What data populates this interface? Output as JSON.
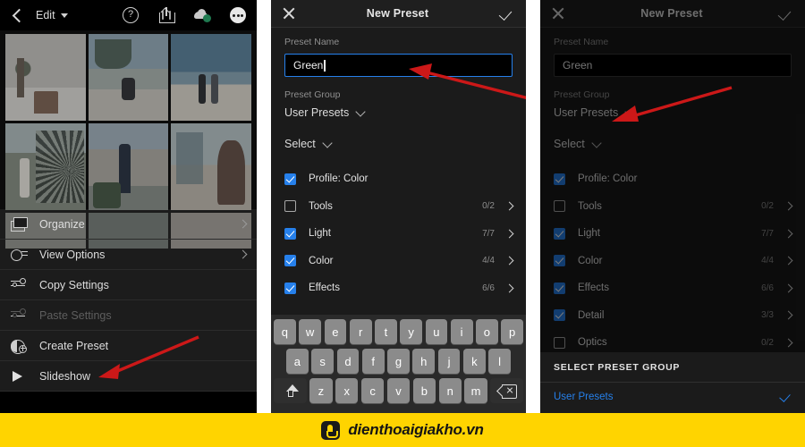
{
  "panel_left": {
    "topbar": {
      "back_icon": "back-chevron-icon",
      "title": "Edit",
      "icons": [
        {
          "name": "help-icon",
          "glyph": "?"
        },
        {
          "name": "share-icon",
          "glyph": "share"
        },
        {
          "name": "cloud-sync-icon",
          "glyph": "cloud"
        },
        {
          "name": "more-options-icon",
          "glyph": "•••"
        }
      ]
    },
    "menu": [
      {
        "label": "Organize",
        "icon": "organize-icon",
        "has_arrow": true,
        "disabled": false
      },
      {
        "label": "View Options",
        "icon": "view-options-icon",
        "has_arrow": true,
        "disabled": false
      },
      {
        "label": "Copy Settings",
        "icon": "copy-settings-icon",
        "has_arrow": false,
        "disabled": false
      },
      {
        "label": "Paste Settings",
        "icon": "paste-settings-icon",
        "has_arrow": false,
        "disabled": true
      },
      {
        "label": "Create Preset",
        "icon": "create-preset-icon",
        "has_arrow": false,
        "disabled": false
      },
      {
        "label": "Slideshow",
        "icon": "slideshow-icon",
        "has_arrow": false,
        "disabled": false
      }
    ]
  },
  "panel_mid": {
    "header": {
      "close_icon": "close-icon",
      "title": "New Preset",
      "confirm_icon": "checkmark-icon"
    },
    "preset_name_label": "Preset Name",
    "preset_name_value": "Green",
    "preset_group_label": "Preset Group",
    "preset_group_value": "User Presets",
    "select_label": "Select",
    "items": [
      {
        "label": "Profile: Color",
        "checked": true,
        "count": "",
        "chevron": false
      },
      {
        "label": "Tools",
        "checked": false,
        "count": "0/2",
        "chevron": true
      },
      {
        "label": "Light",
        "checked": true,
        "count": "7/7",
        "chevron": true
      },
      {
        "label": "Color",
        "checked": true,
        "count": "4/4",
        "chevron": true
      },
      {
        "label": "Effects",
        "checked": true,
        "count": "6/6",
        "chevron": true
      }
    ],
    "keyboard": {
      "row1": [
        "q",
        "w",
        "e",
        "r",
        "t",
        "y",
        "u",
        "i",
        "o",
        "p"
      ],
      "row2": [
        "a",
        "s",
        "d",
        "f",
        "g",
        "h",
        "j",
        "k",
        "l"
      ],
      "row3": [
        "z",
        "x",
        "c",
        "v",
        "b",
        "n",
        "m"
      ],
      "shift_key": "shift-key-icon",
      "backspace_key": "backspace-key-icon"
    }
  },
  "panel_right": {
    "header": {
      "close_icon": "close-icon",
      "title": "New Preset",
      "confirm_icon": "checkmark-icon"
    },
    "preset_name_label": "Preset Name",
    "preset_name_value": "Green",
    "preset_group_label": "Preset Group",
    "preset_group_value": "User Presets",
    "select_label": "Select",
    "items": [
      {
        "label": "Profile: Color",
        "checked": true,
        "count": "",
        "chevron": false
      },
      {
        "label": "Tools",
        "checked": false,
        "count": "0/2",
        "chevron": true
      },
      {
        "label": "Light",
        "checked": true,
        "count": "7/7",
        "chevron": true
      },
      {
        "label": "Color",
        "checked": true,
        "count": "4/4",
        "chevron": true
      },
      {
        "label": "Effects",
        "checked": true,
        "count": "6/6",
        "chevron": true
      },
      {
        "label": "Detail",
        "checked": true,
        "count": "3/3",
        "chevron": true
      },
      {
        "label": "Optics",
        "checked": false,
        "count": "0/2",
        "chevron": true
      }
    ],
    "sheet": {
      "title": "SELECT PRESET GROUP",
      "option_label": "User Presets",
      "option_selected": true
    }
  },
  "footer": {
    "watermark_icon": "app-logo-icon",
    "watermark_text": "dienthoaigiakho.vn"
  },
  "colors": {
    "accent_blue": "#2680eb",
    "annotation_red": "#cc1818",
    "footer_yellow": "#ffd400",
    "panel_bg": "#1b1b1b"
  }
}
